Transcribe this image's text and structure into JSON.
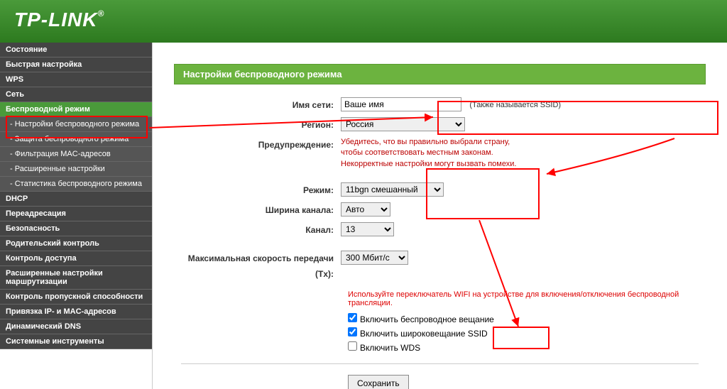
{
  "brand": "TP-LINK",
  "sidebar": {
    "items": [
      {
        "label": "Состояние"
      },
      {
        "label": "Быстрая настройка"
      },
      {
        "label": "WPS"
      },
      {
        "label": "Сеть"
      },
      {
        "label": "Беспроводной режим",
        "active": true
      },
      {
        "label": "- Настройки беспроводного режима",
        "sub": true
      },
      {
        "label": "- Защита беспроводного режима",
        "sub": true
      },
      {
        "label": "- Фильтрация MAC-адресов",
        "sub": true
      },
      {
        "label": "- Расширенные настройки",
        "sub": true
      },
      {
        "label": "- Статистика беспроводного режима",
        "sub": true
      },
      {
        "label": "DHCP"
      },
      {
        "label": "Переадресация"
      },
      {
        "label": "Безопасность"
      },
      {
        "label": "Родительский контроль"
      },
      {
        "label": "Контроль доступа"
      },
      {
        "label": "Расширенные настройки маршрутизации"
      },
      {
        "label": "Контроль пропускной способности"
      },
      {
        "label": "Привязка IP- и MAC-адресов"
      },
      {
        "label": "Динамический DNS"
      },
      {
        "label": "Системные инструменты"
      }
    ]
  },
  "page": {
    "title": "Настройки беспроводного режима",
    "ssid_label": "Имя сети:",
    "ssid_value": "Ваше имя",
    "ssid_hint": "(Также называется SSID)",
    "region_label": "Регион:",
    "region_value": "Россия",
    "warn_label": "Предупреждение:",
    "warn_text1": "Убедитесь, что вы правильно выбрали страну,",
    "warn_text2": "чтобы соответствовать местным законам.",
    "warn_text3": "Некорректные настройки могут вызвать помехи.",
    "mode_label": "Режим:",
    "mode_value": "11bgn смешанный",
    "width_label": "Ширина канала:",
    "width_value": "Авто",
    "channel_label": "Канал:",
    "channel_value": "13",
    "speed_label": "Максимальная скорость передачи (Tx):",
    "speed_value": "300 Мбит/с",
    "notice": "Используйте переключатель WIFI на устройстве для включения/отключения беспроводной трансляции.",
    "chk1": "Включить беспроводное вещание",
    "chk2": "Включить широковещание SSID",
    "chk3": "Включить WDS",
    "save": "Сохранить"
  }
}
